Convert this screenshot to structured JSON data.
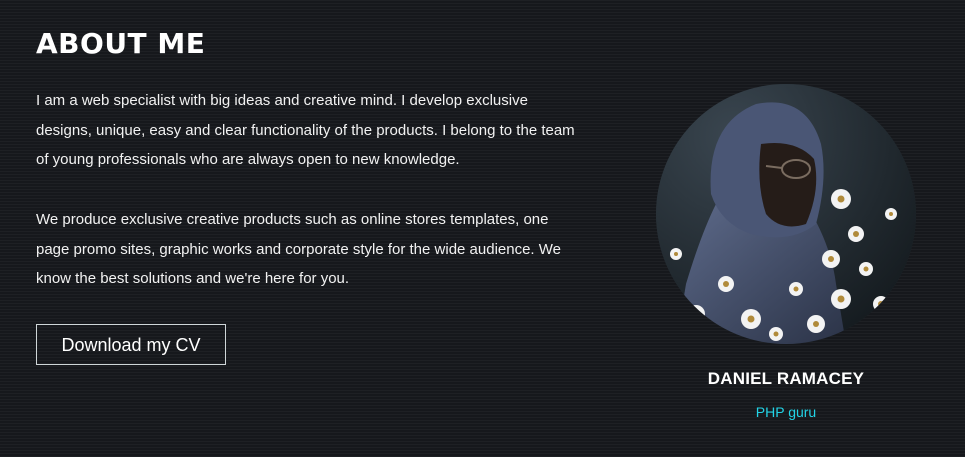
{
  "about": {
    "title": "ABOUT ME",
    "paragraph_1": "I am a web specialist with big ideas and creative mind. I develop exclusive designs, unique, easy and clear functionality of the products. I belong to the team of young professionals who are always open to new knowledge.",
    "paragraph_2": "We produce exclusive creative products such as online stores templates, one page promo sites, graphic works and corporate style for the wide audience. We know the best solutions and we're here for you.",
    "cv_button_label": "Download my CV"
  },
  "profile": {
    "name": "DANIEL RAMACEY",
    "role": "PHP guru",
    "photo": "portrait-with-daisies",
    "role_color": "#22d3e6"
  },
  "colors": {
    "background": "#16181c",
    "text": "#ffffff",
    "accent": "#22d3e6"
  }
}
